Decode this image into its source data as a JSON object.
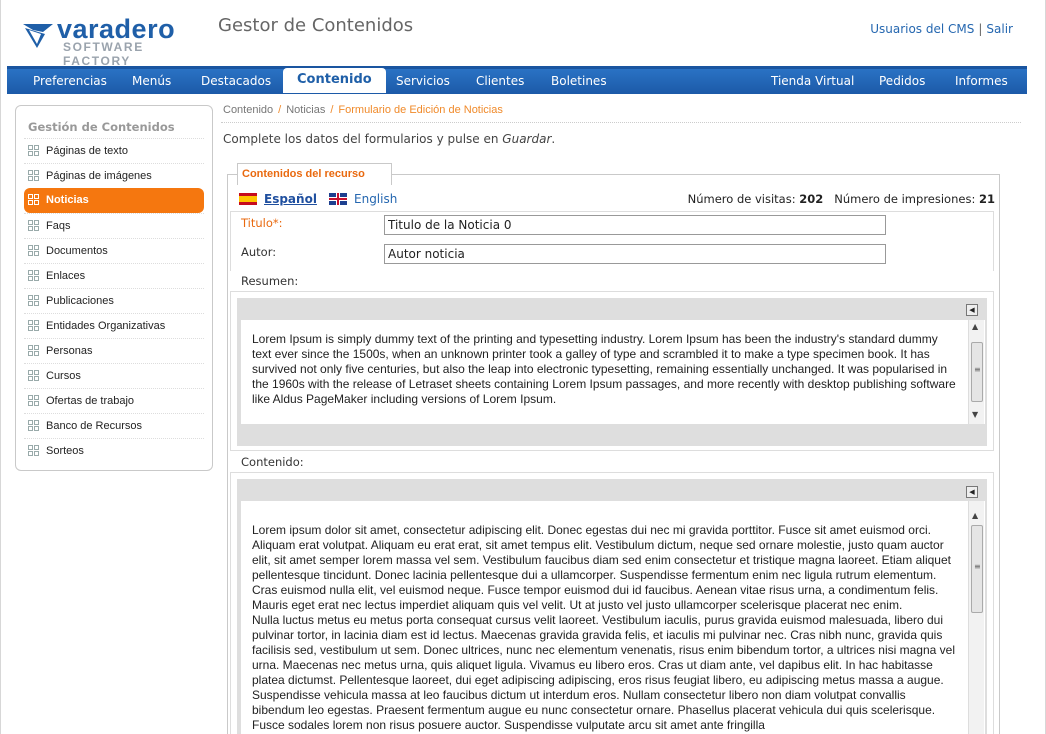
{
  "header": {
    "logo_text": "varadero",
    "logo_sub": "SOFTWARE FACTORY",
    "app_title": "Gestor de Contenidos",
    "links": [
      "Usuarios del CMS",
      "Salir"
    ],
    "link_separator": "|"
  },
  "nav": {
    "items": [
      "Preferencias",
      "Menús",
      "Destacados",
      "Contenido",
      "Servicios",
      "Clientes",
      "Boletines",
      "Tienda Virtual",
      "Pedidos",
      "Informes"
    ],
    "active": "Contenido"
  },
  "sidebar": {
    "title": "Gestión de Contenidos",
    "items": [
      "Páginas de texto",
      "Páginas de imágenes",
      "Noticias",
      "Faqs",
      "Documentos",
      "Enlaces",
      "Publicaciones",
      "Entidades Organizativas",
      "Personas",
      "Cursos",
      "Ofertas de trabajo",
      "Banco de Recursos",
      "Sorteos"
    ],
    "active": "Noticias"
  },
  "breadcrumb": {
    "items": [
      "Contenido",
      "Noticias",
      "Formulario de Edición de Noticias"
    ],
    "separator": "/"
  },
  "instructions": {
    "prefix": "Complete los datos del formularios y pulse en ",
    "emphasis": "Guardar",
    "suffix": "."
  },
  "panel": {
    "tab_label": "Contenidos del recurso",
    "languages": [
      "Español",
      "English"
    ],
    "active_language": "Español",
    "stats": {
      "visits_label": "Número de visitas:",
      "visits": "202",
      "impressions_label": "Número de impresiones:",
      "impressions": "21"
    },
    "title_label": "Titulo*:",
    "title_value": "Titulo de la Noticia 0",
    "author_label": "Autor:",
    "author_value": "Autor noticia",
    "summary_label": "Resumen:",
    "summary_text": "Lorem Ipsum is simply dummy text of the printing and typesetting industry. Lorem Ipsum has been the industry's standard dummy text ever since the 1500s, when an unknown printer took a galley of type and scrambled it to make a type specimen book. It has survived not only five centuries, but also the leap into electronic typesetting, remaining essentially unchanged. It was popularised in the 1960s with the release of Letraset sheets containing Lorem Ipsum passages, and more recently with desktop publishing software like Aldus PageMaker including versions of Lorem Ipsum.",
    "content_label": "Contenido:",
    "content_para1": "Lorem ipsum dolor sit amet, consectetur adipiscing elit. Donec egestas dui nec mi gravida porttitor. Fusce sit amet euismod orci. Aliquam erat volutpat. Aliquam eu erat erat, sit amet tempus elit. Vestibulum dictum, neque sed ornare molestie, justo quam auctor elit, sit amet semper lorem massa vel sem. Vestibulum faucibus diam sed enim consectetur et tristique magna laoreet. Etiam aliquet pellentesque tincidunt. Donec lacinia pellentesque dui a ullamcorper. Suspendisse fermentum enim nec ligula rutrum elementum. Cras euismod nulla elit, vel euismod neque. Fusce tempor euismod dui id faucibus. Aenean vitae risus urna, a condimentum felis. Mauris eget erat nec lectus imperdiet aliquam quis vel velit. Ut at justo vel justo ullamcorper scelerisque placerat nec enim.",
    "content_para2": "Nulla luctus metus eu metus porta consequat cursus velit laoreet. Vestibulum iaculis, purus gravida euismod malesuada, libero dui pulvinar tortor, in lacinia diam est id lectus. Maecenas gravida gravida felis, et iaculis mi pulvinar nec. Cras nibh nunc, gravida quis facilisis sed, vestibulum ut sem. Donec ultrices, nunc nec elementum venenatis, risus enim bibendum tortor, a ultrices nisi magna vel urna. Maecenas nec metus urna, quis aliquet ligula. Vivamus eu libero eros. Cras ut diam ante, vel dapibus elit. In hac habitasse platea dictumst. Pellentesque laoreet, dui eget adipiscing adipiscing, eros risus feugiat libero, eu adipiscing metus massa a augue. Suspendisse vehicula massa at leo faucibus dictum ut interdum eros. Nullam consectetur libero non diam volutpat convallis bibendum leo egestas. Praesent fermentum augue eu nunc consectetur ornare. Phasellus placerat vehicula dui quis scelerisque. Fusce sodales lorem non risus posuere auctor. Suspendisse vulputate arcu sit amet ante fringilla"
  },
  "colors": {
    "brand_blue": "#1f5fa8",
    "accent_orange": "#f5770f"
  },
  "icons": {
    "list_item": "grid-icon",
    "flag_es": "spain-flag-icon",
    "flag_en": "uk-flag-icon"
  }
}
